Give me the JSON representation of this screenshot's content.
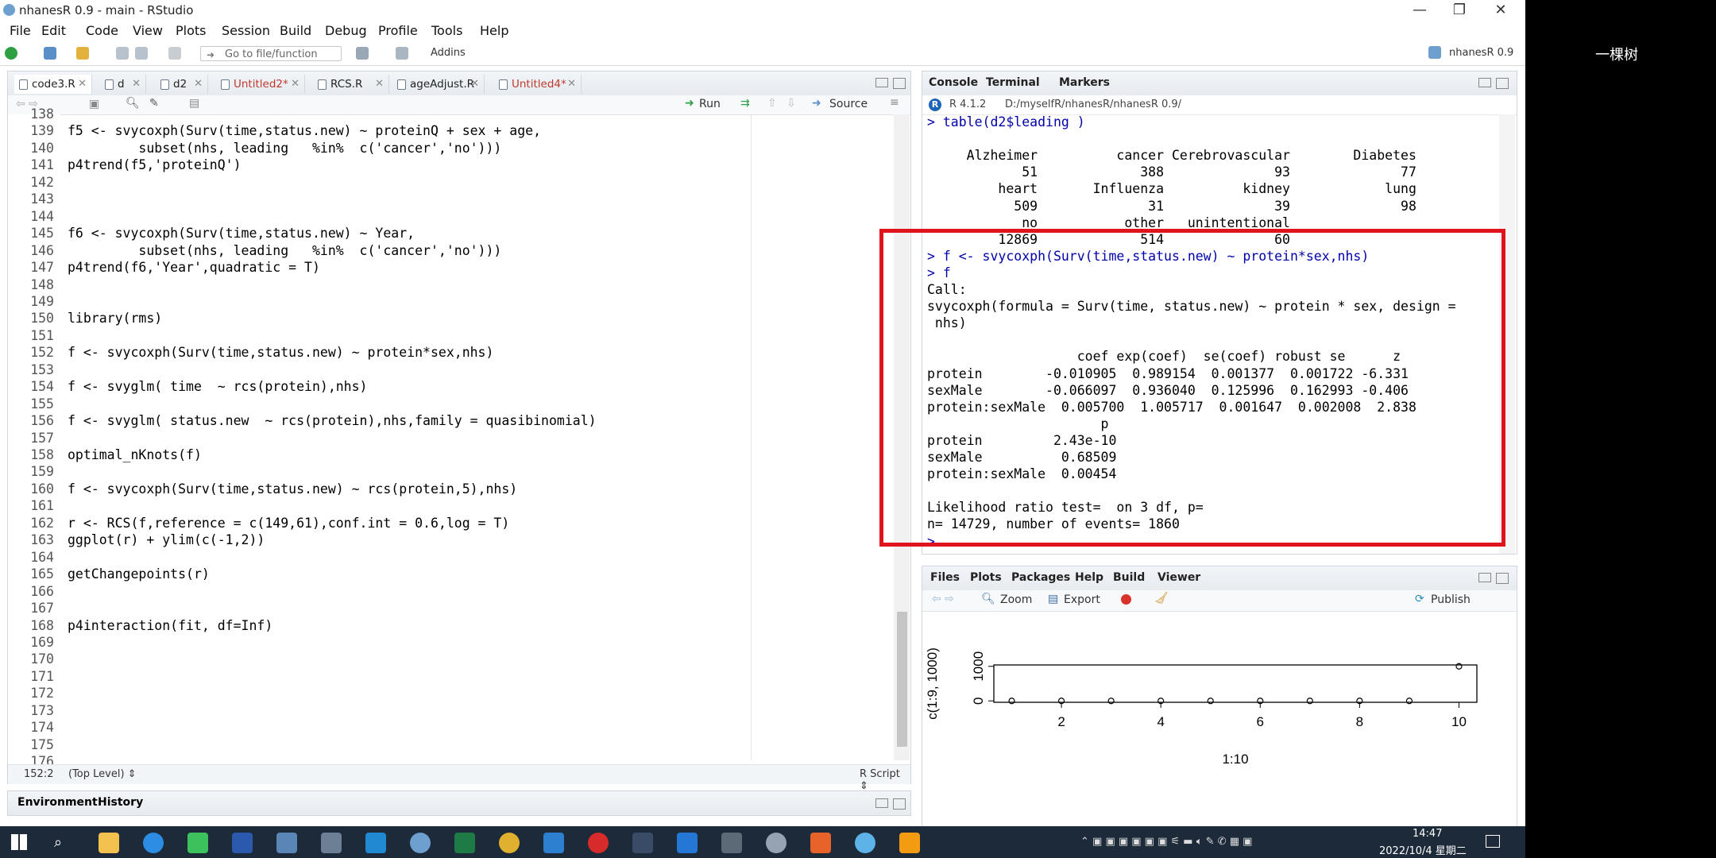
{
  "window": {
    "title": "nhanesR 0.9 - main - RStudio",
    "controls": [
      "—",
      "❐",
      "✕"
    ]
  },
  "menu": [
    "File",
    "Edit",
    "Code",
    "View",
    "Plots",
    "Session",
    "Build",
    "Debug",
    "Profile",
    "Tools",
    "Help"
  ],
  "toolbar": {
    "goto_placeholder": "Go to file/function",
    "addins_label": "Addins",
    "project_label": "nhanesR 0.9"
  },
  "source": {
    "tabs": [
      {
        "label": "code3.R",
        "unsaved": false
      },
      {
        "label": "d",
        "unsaved": false
      },
      {
        "label": "d2",
        "unsaved": false
      },
      {
        "label": "Untitled2*",
        "unsaved": true
      },
      {
        "label": "RCS.R",
        "unsaved": false
      },
      {
        "label": "ageAdjust.R",
        "unsaved": false
      },
      {
        "label": "Untitled4*",
        "unsaved": true
      }
    ],
    "run_label": "Run",
    "source_label": "Source",
    "lines": [
      {
        "n": "138",
        "t": ""
      },
      {
        "n": "139",
        "t": "f5 <- svycoxph(Surv(time,status.new) ~ proteinQ + sex + age,"
      },
      {
        "n": "140",
        "t": "         subset(nhs, leading   %in%  c('cancer','no')))"
      },
      {
        "n": "141",
        "t": "p4trend(f5,'proteinQ')"
      },
      {
        "n": "142",
        "t": ""
      },
      {
        "n": "143",
        "t": ""
      },
      {
        "n": "144",
        "t": ""
      },
      {
        "n": "145",
        "t": "f6 <- svycoxph(Surv(time,status.new) ~ Year,"
      },
      {
        "n": "146",
        "t": "         subset(nhs, leading   %in%  c('cancer','no')))"
      },
      {
        "n": "147",
        "t": "p4trend(f6,'Year',quadratic = T)"
      },
      {
        "n": "148",
        "t": ""
      },
      {
        "n": "149",
        "t": ""
      },
      {
        "n": "150",
        "t": "library(rms)"
      },
      {
        "n": "151",
        "t": ""
      },
      {
        "n": "152",
        "t": "f <- svycoxph(Surv(time,status.new) ~ protein*sex,nhs)"
      },
      {
        "n": "153",
        "t": ""
      },
      {
        "n": "154",
        "t": "f <- svyglm( time  ~ rcs(protein),nhs)"
      },
      {
        "n": "155",
        "t": ""
      },
      {
        "n": "156",
        "t": "f <- svyglm( status.new  ~ rcs(protein),nhs,family = quasibinomial)"
      },
      {
        "n": "157",
        "t": ""
      },
      {
        "n": "158",
        "t": "optimal_nKnots(f)"
      },
      {
        "n": "159",
        "t": ""
      },
      {
        "n": "160",
        "t": "f <- svycoxph(Surv(time,status.new) ~ rcs(protein,5),nhs)"
      },
      {
        "n": "161",
        "t": ""
      },
      {
        "n": "162",
        "t": "r <- RCS(f,reference = c(149,61),conf.int = 0.6,log = T)"
      },
      {
        "n": "163",
        "t": "ggplot(r) + ylim(c(-1,2))"
      },
      {
        "n": "164",
        "t": ""
      },
      {
        "n": "165",
        "t": "getChangepoints(r)"
      },
      {
        "n": "166",
        "t": ""
      },
      {
        "n": "167",
        "t": ""
      },
      {
        "n": "168",
        "t": "p4interaction(fit, df=Inf)"
      },
      {
        "n": "169",
        "t": ""
      },
      {
        "n": "170",
        "t": ""
      },
      {
        "n": "171",
        "t": ""
      },
      {
        "n": "172",
        "t": ""
      },
      {
        "n": "173",
        "t": ""
      },
      {
        "n": "174",
        "t": ""
      },
      {
        "n": "175",
        "t": ""
      },
      {
        "n": "176",
        "t": ""
      }
    ],
    "status_position": "152:2",
    "status_level": "(Top Level) ⇕",
    "status_type": "R Script ⇕"
  },
  "env": {
    "tabs": [
      "Environment",
      "History"
    ]
  },
  "console": {
    "tabs": [
      "Console",
      "Terminal",
      "Markers"
    ],
    "r_version": "R 4.1.2",
    "path": "D:/myselfR/nhanesR/nhanesR 0.9/",
    "lines": [
      {
        "t": "> table(d2$leading )",
        "cmd": true
      },
      {
        "t": "",
        "cmd": false
      },
      {
        "t": "     Alzheimer          cancer Cerebrovascular        Diabetes",
        "cmd": false
      },
      {
        "t": "            51             388              93              77",
        "cmd": false
      },
      {
        "t": "         heart       Influenza          kidney            lung",
        "cmd": false
      },
      {
        "t": "           509              31              39              98",
        "cmd": false
      },
      {
        "t": "            no           other   unintentional",
        "cmd": false
      },
      {
        "t": "         12869             514              60",
        "cmd": false
      },
      {
        "t": "> f <- svycoxph(Surv(time,status.new) ~ protein*sex,nhs)",
        "cmd": true
      },
      {
        "t": "> f",
        "cmd": true
      },
      {
        "t": "Call:",
        "cmd": false
      },
      {
        "t": "svycoxph(formula = Surv(time, status.new) ~ protein * sex, design =",
        "cmd": false
      },
      {
        "t": " nhs)",
        "cmd": false
      },
      {
        "t": "",
        "cmd": false
      },
      {
        "t": "                   coef exp(coef)  se(coef) robust se      z",
        "cmd": false
      },
      {
        "t": "protein        -0.010905  0.989154  0.001377  0.001722 -6.331",
        "cmd": false
      },
      {
        "t": "sexMale        -0.066097  0.936040  0.125996  0.162993 -0.406",
        "cmd": false
      },
      {
        "t": "protein:sexMale  0.005700  1.005717  0.001647  0.002008  2.838",
        "cmd": false
      },
      {
        "t": "                      p",
        "cmd": false
      },
      {
        "t": "protein         2.43e-10",
        "cmd": false
      },
      {
        "t": "sexMale          0.68509",
        "cmd": false
      },
      {
        "t": "protein:sexMale  0.00454",
        "cmd": false
      },
      {
        "t": "",
        "cmd": false
      },
      {
        "t": "Likelihood ratio test=  on 3 df, p=",
        "cmd": false
      },
      {
        "t": "n= 14729, number of events= 1860",
        "cmd": false
      },
      {
        "t": "> ",
        "cmd": true
      }
    ]
  },
  "plots": {
    "tabs": [
      "Files",
      "Plots",
      "Packages",
      "Help",
      "Build",
      "Viewer"
    ],
    "zoom_label": "Zoom",
    "export_label": "Export",
    "publish_label": "Publish"
  },
  "chart_data": {
    "type": "scatter",
    "x": [
      1,
      2,
      3,
      4,
      5,
      6,
      7,
      8,
      9,
      10
    ],
    "y": [
      0,
      0,
      0,
      0,
      0,
      0,
      0,
      0,
      0,
      1000
    ],
    "xlabel": "1:10",
    "ylabel": "c(1:9, 1000)",
    "xticks": [
      "2",
      "4",
      "6",
      "8",
      "10"
    ],
    "yticks": [
      "0",
      "1000"
    ],
    "xlim": [
      0.64,
      10.36
    ],
    "ylim": [
      -40,
      1040
    ]
  },
  "taskbar": {
    "time": "14:47",
    "date": "2022/10/4 星期二"
  },
  "side_label": "一棵树"
}
